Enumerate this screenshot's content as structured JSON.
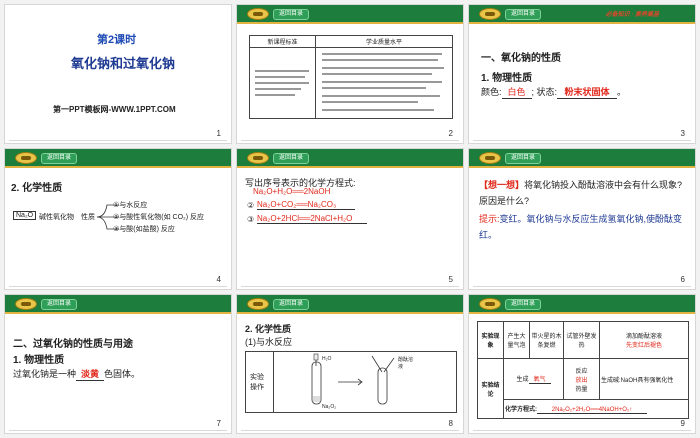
{
  "common": {
    "nav_button": "返回目录"
  },
  "slides": [
    {
      "num": "1",
      "lesson": "第2课时",
      "title": "氧化钠和过氧化钠",
      "watermark": "第一PPT模板网-WWW.1PPT.COM"
    },
    {
      "num": "2",
      "col1_header": "新课程标准",
      "col2_header": "学业质量水平"
    },
    {
      "num": "3",
      "header_tag": "必备知识 · 素养奠基",
      "section": "一、氧化钠的性质",
      "sub": "1. 物理性质",
      "color_label": "颜色:",
      "color_value": "白色",
      "state_label": "; 状态:",
      "state_value": "粉末状固体",
      "end": "。"
    },
    {
      "num": "4",
      "sub": "2. 化学性质",
      "formula": "Na₂O",
      "class_label": "碱性氧化物",
      "prop_label": "性质",
      "branch1": "①与水反应",
      "branch2": "②与酸性氧化物(如 CO₂) 反应",
      "branch3": "③与酸(如盐酸) 反应"
    },
    {
      "num": "5",
      "prompt": "写出序号表示的化学方程式:",
      "eq1": "Na₂O+H₂O══2NaOH",
      "eq2_label": "②",
      "eq2": "Na₂O+CO₂══Na₂CO₃",
      "eq3_label": "③",
      "eq3": "Na₂O+2HCl══2NaCl+H₂O"
    },
    {
      "num": "6",
      "think_tag": "【想一想】",
      "question": "将氧化钠投入酚酞溶液中会有什么现象?原因是什么?",
      "hint_tag": "提示:",
      "answer": "变红。氧化钠与水反应生成氢氧化钠,使酚酞变红。"
    },
    {
      "num": "7",
      "section": "二、过氧化钠的性质与用途",
      "sub": "1. 物理性质",
      "sentence_pre": "过氧化钠是一种",
      "sentence_value": "淡黄",
      "sentence_post": "色固体。"
    },
    {
      "num": "8",
      "sub": "2. 化学性质",
      "sub2": "(1)与水反应",
      "row_label": "实验操作",
      "tube1_label": "H₂O",
      "tube1_bottom": "Na₂O₂",
      "tube2_label": "酚酞溶液"
    },
    {
      "num": "9",
      "row1_label": "实验现象",
      "c1": "产生大量气泡",
      "c2": "带火星的木条复燃",
      "c3": "试管外壁发热",
      "c4_pre": "滴加酚酞溶液",
      "c4_red": "先变红后褪色",
      "row2_label": "实验结论",
      "r2_gen": "生成",
      "r2_gas": "氧气",
      "r2_release": "反应",
      "r2_release_red": "放出",
      "r2_heat": "热量",
      "r2_right": "生成碱:NaOH具有强氧化性",
      "eq_label": "化学方程式:",
      "eq": "2Na₂O₂+2H₂O══4NaOH+O₂↑"
    }
  ]
}
